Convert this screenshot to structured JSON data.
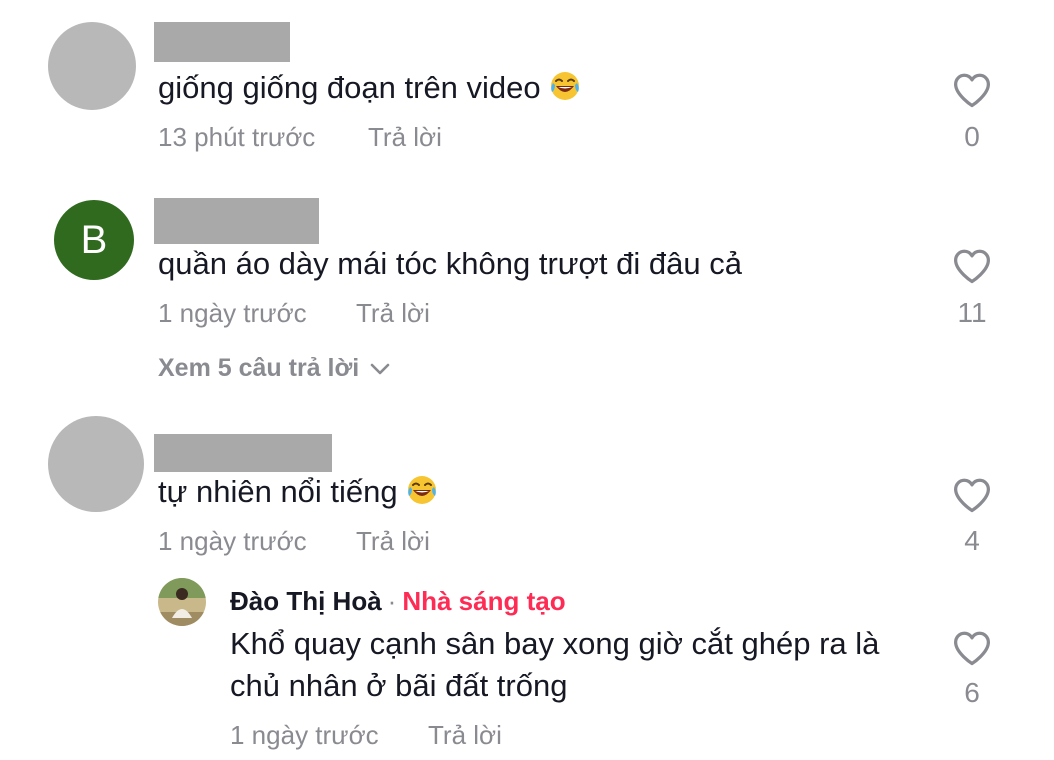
{
  "comments": [
    {
      "text": "giống giống đoạn trên video",
      "emoji": "laughing-tears",
      "time": "13 phút trước",
      "reply_label": "Trả lời",
      "likes": "0"
    },
    {
      "avatar_letter": "B",
      "avatar_color": "#2f6a1f",
      "text": "quần áo dày mái tóc không trượt đi đâu cả",
      "time": "1 ngày trước",
      "reply_label": "Trả lời",
      "likes": "11",
      "view_replies": "Xem 5 câu trả lời"
    },
    {
      "text": "tự nhiên nổi tiếng",
      "emoji": "laughing-tears",
      "time": "1 ngày trước",
      "reply_label": "Trả lời",
      "likes": "4",
      "reply": {
        "author": "Đào Thị Hoà",
        "separator": "·",
        "badge": "Nhà sáng tạo",
        "badge_color": "#fe2c55",
        "text_line1": "Khổ quay cạnh sân bay xong giờ cắt ghép ra là",
        "text_line2": "chủ nhân ở bãi đất trống",
        "time": "1 ngày trước",
        "reply_label": "Trả lời",
        "likes": "6"
      }
    }
  ]
}
